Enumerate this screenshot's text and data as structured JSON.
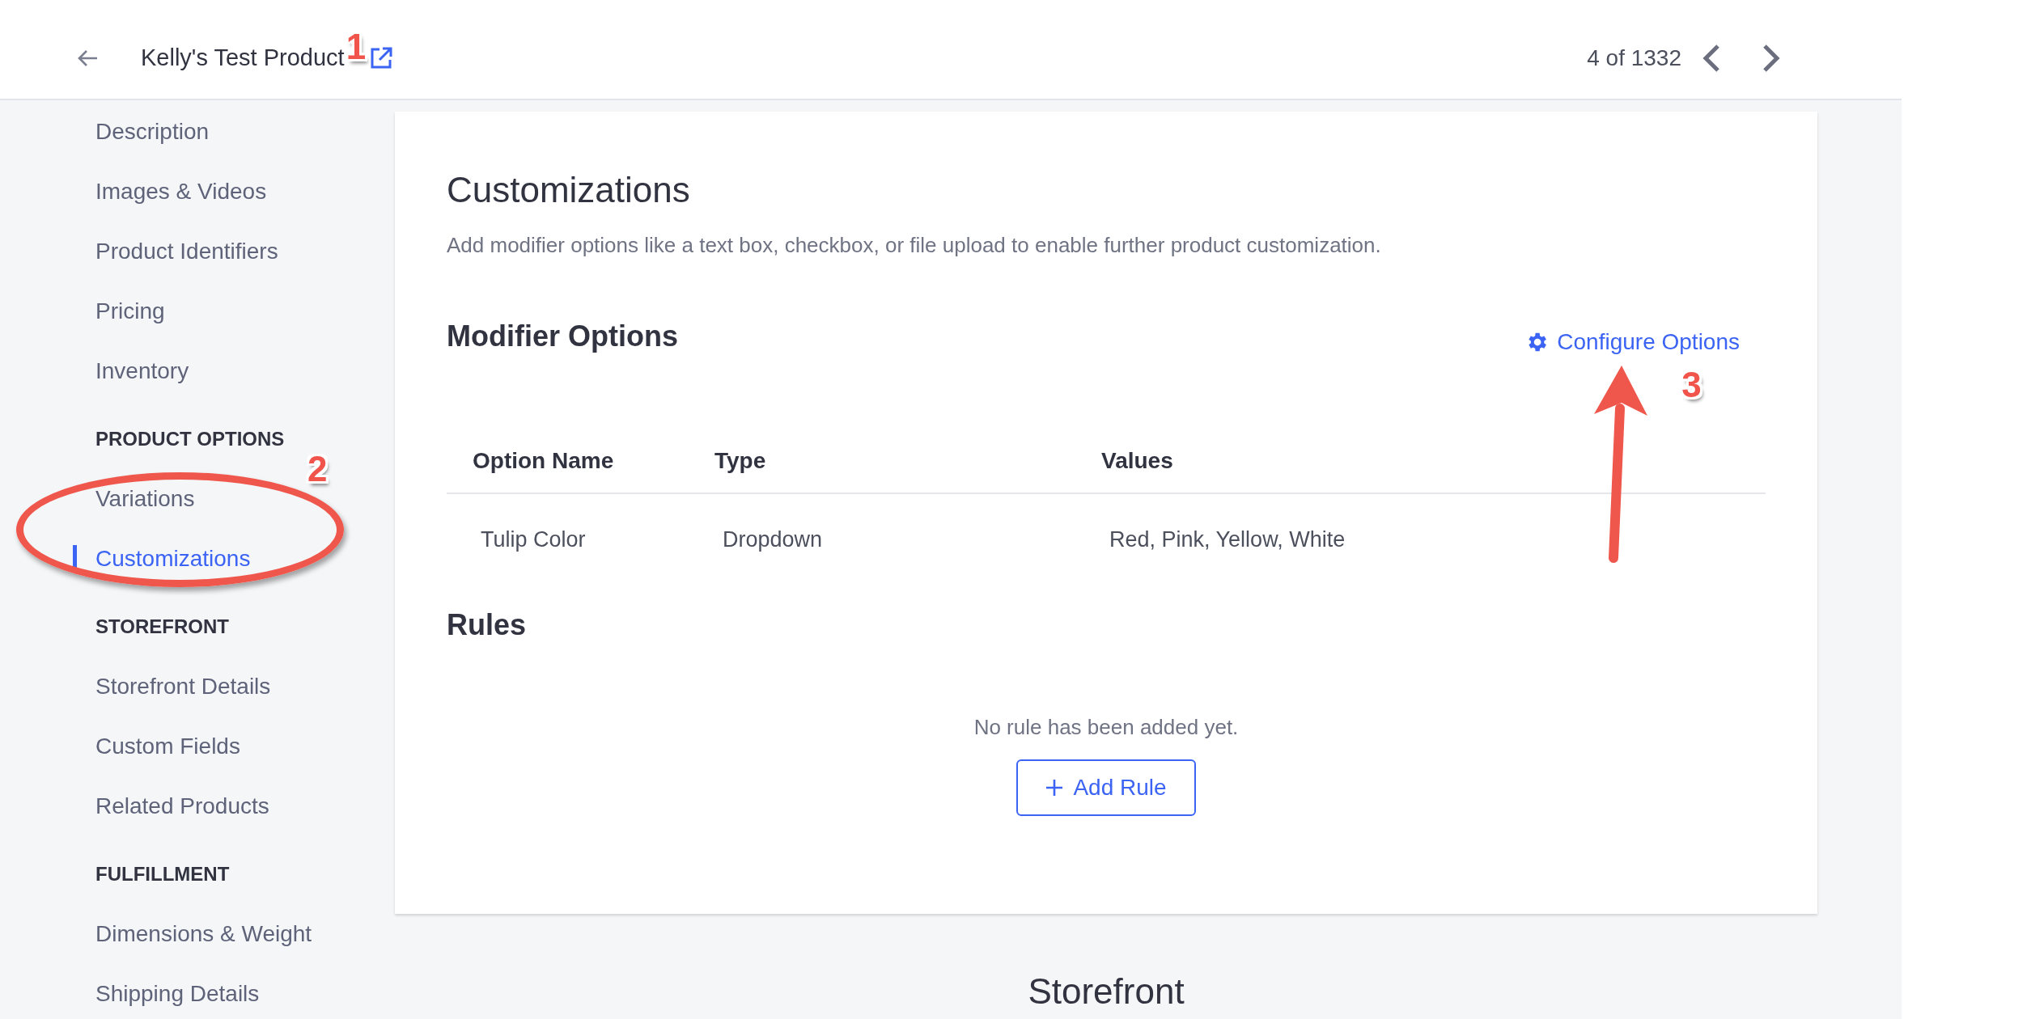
{
  "header": {
    "title": "Kelly's Test Product",
    "title_annotation": "1",
    "pager": "4 of 1332"
  },
  "sidebar": {
    "sections": [
      {
        "items": [
          {
            "label": "Description",
            "selected": false
          },
          {
            "label": "Images & Videos",
            "selected": false
          },
          {
            "label": "Product Identifiers",
            "selected": false
          },
          {
            "label": "Pricing",
            "selected": false
          },
          {
            "label": "Inventory",
            "selected": false
          }
        ]
      },
      {
        "heading": "PRODUCT OPTIONS",
        "items": [
          {
            "label": "Variations",
            "selected": false
          },
          {
            "label": "Customizations",
            "selected": true,
            "circled": true,
            "annotation": "2"
          }
        ]
      },
      {
        "heading": "STOREFRONT",
        "items": [
          {
            "label": "Storefront Details",
            "selected": false
          },
          {
            "label": "Custom Fields",
            "selected": false
          },
          {
            "label": "Related Products",
            "selected": false
          }
        ]
      },
      {
        "heading": "FULFILLMENT",
        "items": [
          {
            "label": "Dimensions & Weight",
            "selected": false
          },
          {
            "label": "Shipping Details",
            "selected": false
          }
        ]
      }
    ]
  },
  "card": {
    "title": "Customizations",
    "description": "Add modifier options like a text box, checkbox, or file upload to enable further product customization.",
    "modifier_options": {
      "title": "Modifier Options",
      "configure_label": "Configure Options",
      "configure_annotation": "3",
      "configure_arrow": true,
      "columns": [
        "Option Name",
        "Type",
        "Values"
      ],
      "rows": [
        [
          "Tulip Color",
          "Dropdown",
          "Red, Pink, Yellow, White"
        ]
      ]
    },
    "rules": {
      "title": "Rules",
      "empty_text": "No rule has been added yet.",
      "add_label": "Add Rule"
    }
  },
  "next_section_title": "Storefront"
}
